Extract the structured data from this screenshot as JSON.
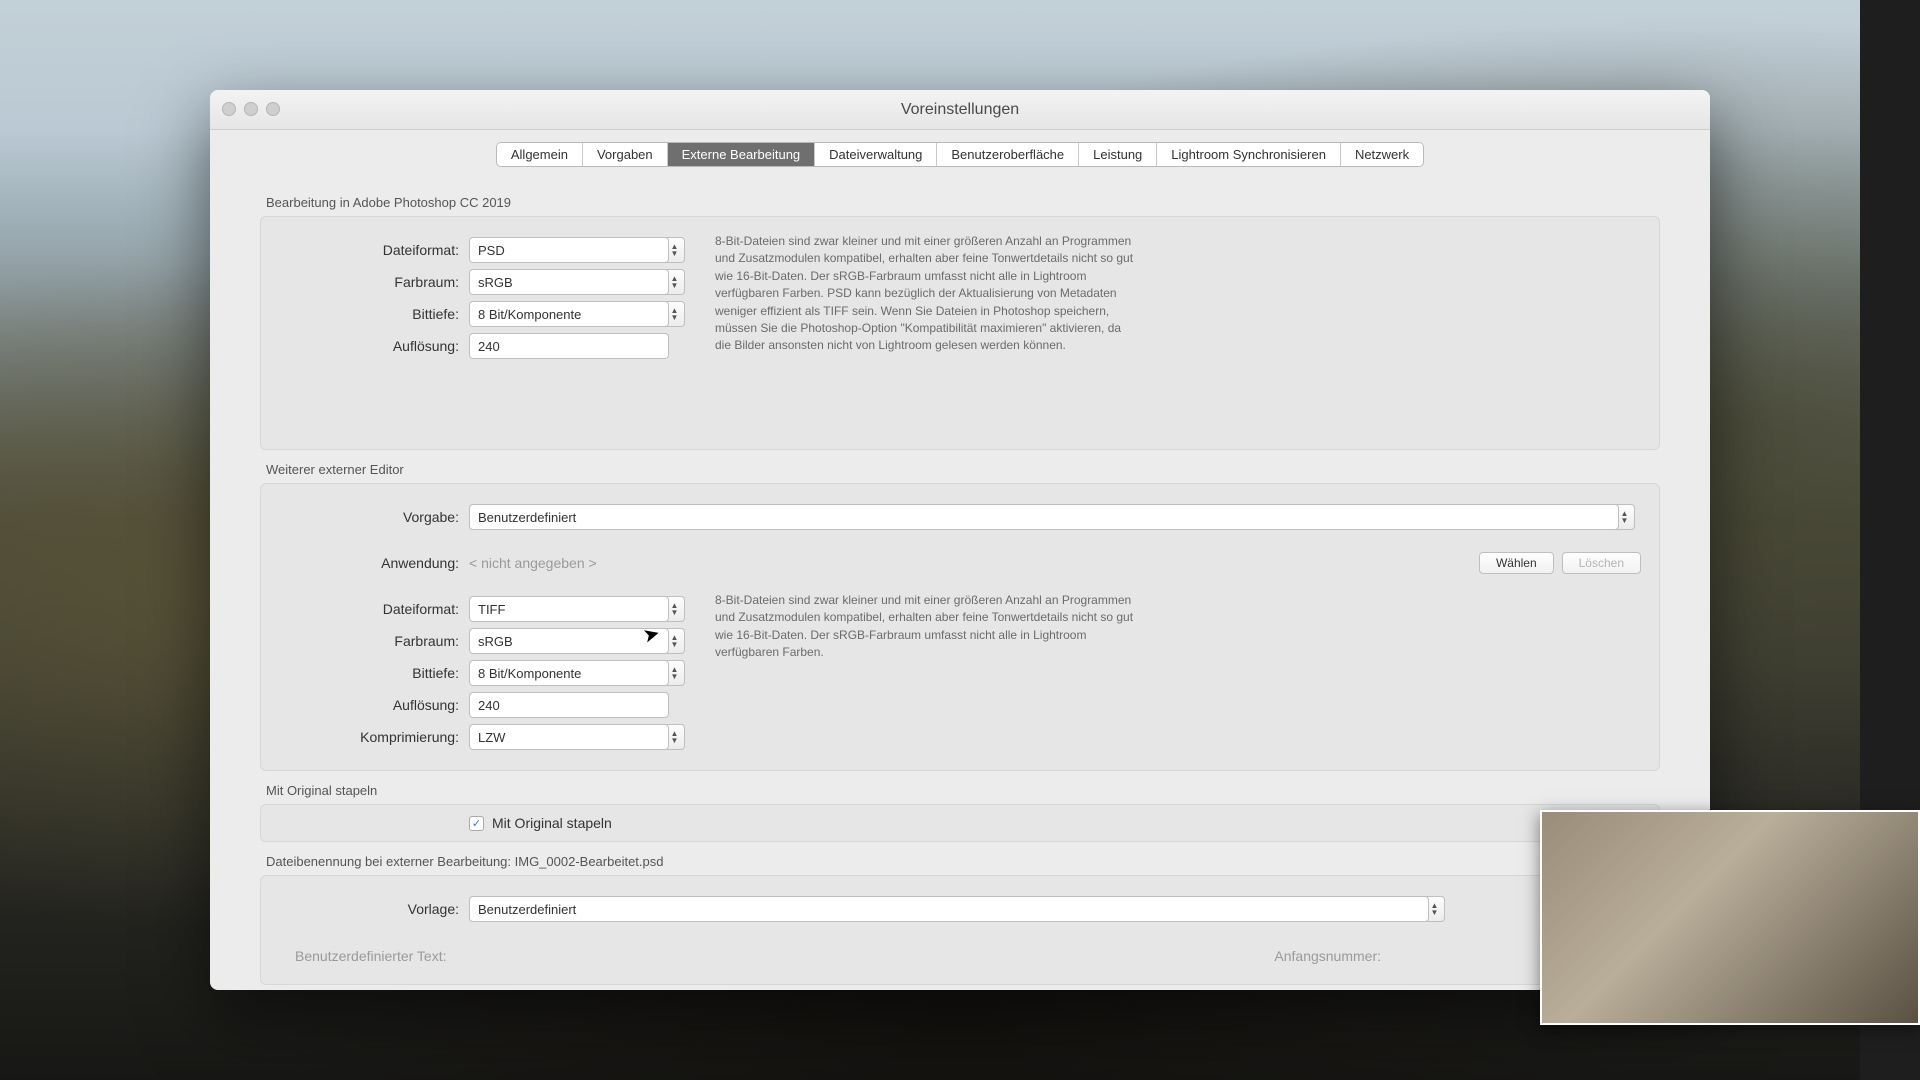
{
  "window": {
    "title": "Voreinstellungen"
  },
  "tabs": {
    "items": [
      {
        "label": "Allgemein"
      },
      {
        "label": "Vorgaben"
      },
      {
        "label": "Externe Bearbeitung",
        "active": true
      },
      {
        "label": "Dateiverwaltung"
      },
      {
        "label": "Benutzeroberfläche"
      },
      {
        "label": "Leistung"
      },
      {
        "label": "Lightroom Synchronisieren"
      },
      {
        "label": "Netzwerk"
      }
    ]
  },
  "section1": {
    "title": "Bearbeitung in Adobe Photoshop CC 2019",
    "fields": {
      "dateiformat": {
        "label": "Dateiformat:",
        "value": "PSD"
      },
      "farbraum": {
        "label": "Farbraum:",
        "value": "sRGB"
      },
      "bittiefe": {
        "label": "Bittiefe:",
        "value": "8 Bit/Komponente"
      },
      "aufloesung": {
        "label": "Auflösung:",
        "value": "240"
      }
    },
    "hint": "8-Bit-Dateien sind zwar kleiner und mit einer größeren Anzahl an Programmen und Zusatzmodulen kompatibel, erhalten aber feine Tonwertdetails nicht so gut wie 16-Bit-Daten. Der sRGB-Farbraum umfasst nicht alle in Lightroom verfügbaren Farben. PSD kann bezüglich der Aktualisierung von Metadaten weniger effizient als TIFF sein. Wenn Sie Dateien in Photoshop speichern, müssen Sie die Photoshop-Option \"Kompatibilität maximieren\" aktivieren, da die Bilder ansonsten nicht von Lightroom gelesen werden können."
  },
  "section2": {
    "title": "Weiterer externer Editor",
    "fields": {
      "vorgabe": {
        "label": "Vorgabe:",
        "value": "Benutzerdefiniert"
      },
      "anwendung": {
        "label": "Anwendung:",
        "value": "< nicht angegeben >"
      },
      "dateiformat": {
        "label": "Dateiformat:",
        "value": "TIFF"
      },
      "farbraum": {
        "label": "Farbraum:",
        "value": "sRGB"
      },
      "bittiefe": {
        "label": "Bittiefe:",
        "value": "8 Bit/Komponente"
      },
      "aufloesung": {
        "label": "Auflösung:",
        "value": "240"
      },
      "komprimierung": {
        "label": "Komprimierung:",
        "value": "LZW"
      }
    },
    "buttons": {
      "waehlen": "Wählen",
      "loeschen": "Löschen"
    },
    "hint": "8-Bit-Dateien sind zwar kleiner und mit einer größeren Anzahl an Programmen und Zusatzmodulen kompatibel, erhalten aber feine Tonwertdetails nicht so gut wie 16-Bit-Daten. Der sRGB-Farbraum umfasst nicht alle in Lightroom verfügbaren Farben."
  },
  "section3": {
    "title": "Mit Original stapeln",
    "checkbox": {
      "label": "Mit Original stapeln",
      "checked": true
    }
  },
  "section4": {
    "title": "Dateibenennung bei externer Bearbeitung: IMG_0002-Bearbeitet.psd",
    "fields": {
      "vorlage": {
        "label": "Vorlage:",
        "value": "Benutzerdefiniert"
      },
      "customtext": {
        "label": "Benutzerdefinierter Text:"
      },
      "startnum": {
        "label": "Anfangsnummer:"
      }
    }
  }
}
